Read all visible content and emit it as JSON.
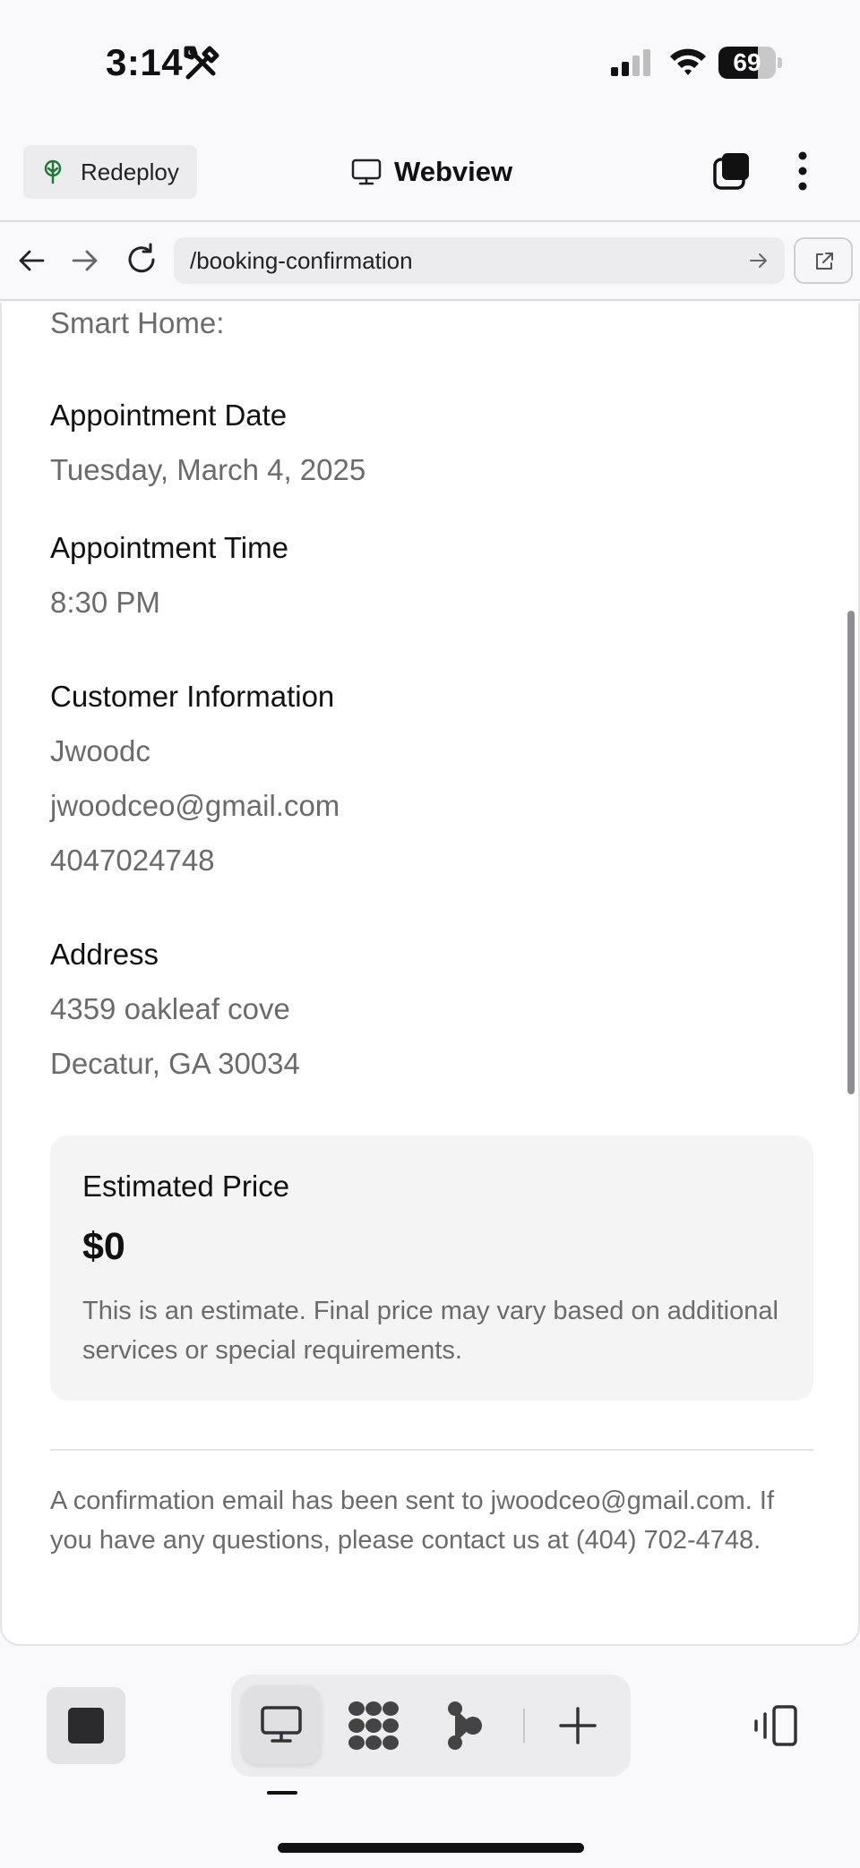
{
  "status_bar": {
    "time": "3:14",
    "battery_level": "69",
    "battery_fraction": 0.69
  },
  "toolbar": {
    "redeploy_label": "Redeploy",
    "title": "Webview"
  },
  "url_bar": {
    "url": "/booking-confirmation"
  },
  "content": {
    "smart_home_label": "Smart Home:",
    "appointment_date": {
      "title": "Appointment Date",
      "value": "Tuesday, March 4, 2025"
    },
    "appointment_time": {
      "title": "Appointment Time",
      "value": "8:30 PM"
    },
    "customer": {
      "title": "Customer Information",
      "name": "Jwoodc",
      "email": "jwoodceo@gmail.com",
      "phone": "4047024748"
    },
    "address": {
      "title": "Address",
      "line1": "4359 oakleaf cove",
      "line2": "Decatur, GA 30034"
    },
    "price": {
      "label": "Estimated Price",
      "value": "$0",
      "note": "This is an estimate. Final price may vary based on additional services or special requirements."
    },
    "confirmation_note": "A confirmation email has been sent to jwoodceo@gmail.com. If you have any questions, please contact us at (404) 702-4748."
  },
  "icons": {
    "status": [
      "tools-icon",
      "cellular-signal-icon",
      "wifi-icon",
      "battery-icon"
    ],
    "toolbar": [
      "redeploy-icon",
      "monitor-icon",
      "tabs-icon",
      "more-vertical-icon"
    ],
    "nav": [
      "back-arrow-icon",
      "forward-arrow-icon",
      "reload-icon",
      "go-arrow-icon",
      "open-external-icon"
    ],
    "dock": [
      "stop-icon",
      "monitor-icon",
      "grid-blob-icon",
      "flow-icon",
      "plus-icon",
      "panel-toggle-icon"
    ]
  },
  "colors": {
    "muted_text": "#6b6b6b",
    "card_background": "#f4f4f5",
    "chrome_background": "#f9f9fb"
  }
}
